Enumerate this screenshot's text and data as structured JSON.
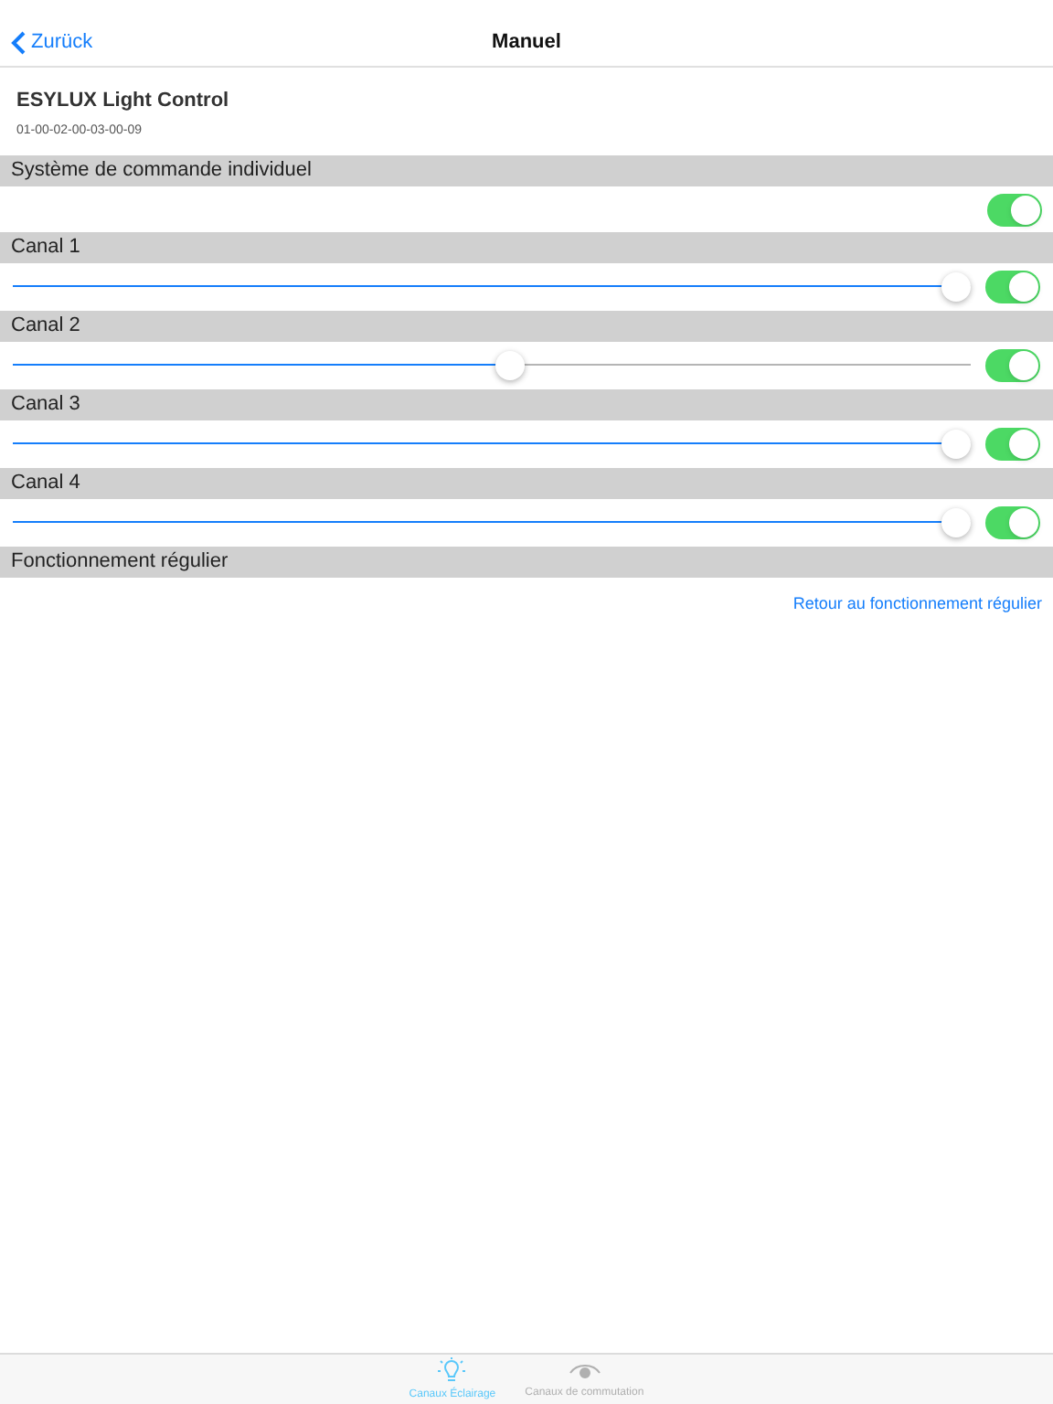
{
  "nav": {
    "back": "Zurück",
    "title": "Manuel"
  },
  "device": {
    "name": "ESYLUX Light Control",
    "id": "01-00-02-00-03-00-09"
  },
  "sections": [
    {
      "header": "Système de commande individuel",
      "kind": "switch",
      "on": true
    },
    {
      "header": "Canal 1",
      "kind": "slider",
      "level": 1,
      "on": true
    },
    {
      "header": "Canal 2",
      "kind": "slider",
      "level": 0.52,
      "on": true
    },
    {
      "header": "Canal 3",
      "kind": "slider",
      "level": 1,
      "on": true
    },
    {
      "header": "Canal 4",
      "kind": "slider",
      "level": 1,
      "on": true
    },
    {
      "header": "Fonctionnement régulier",
      "kind": "link",
      "link": "Retour au fonctionnement régulier"
    }
  ],
  "tabs": [
    {
      "label": "Canaux Éclairage",
      "kind": "bulb",
      "selected": true
    },
    {
      "label": "Canaux de commutation",
      "kind": "eye",
      "selected": false
    }
  ]
}
